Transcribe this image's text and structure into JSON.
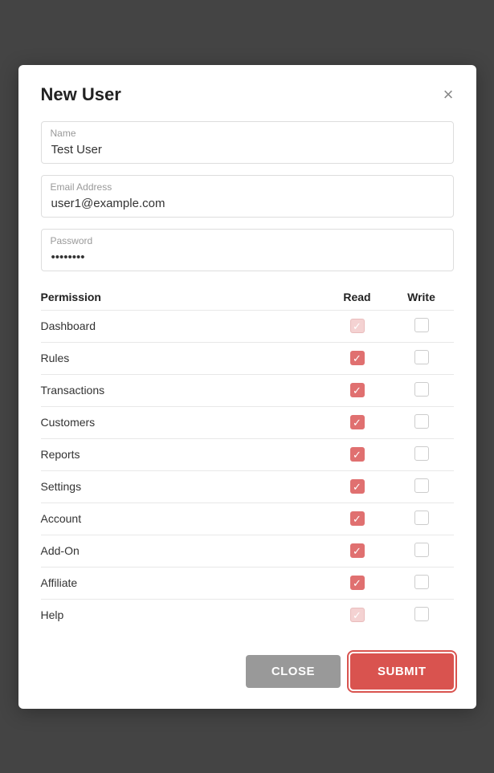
{
  "modal": {
    "title": "New User",
    "close_label": "×"
  },
  "form": {
    "name": {
      "label": "Name",
      "value": "Test User",
      "placeholder": "Name"
    },
    "email": {
      "label": "Email Address",
      "value": "user1@example.com",
      "placeholder": "Email Address"
    },
    "password": {
      "label": "Password",
      "value": "••••••••",
      "placeholder": "Password"
    }
  },
  "permissions": {
    "headers": [
      "Permission",
      "Read",
      "Write"
    ],
    "rows": [
      {
        "name": "Dashboard",
        "read": true,
        "read_disabled": true,
        "write": false
      },
      {
        "name": "Rules",
        "read": true,
        "read_disabled": false,
        "write": false
      },
      {
        "name": "Transactions",
        "read": true,
        "read_disabled": false,
        "write": false
      },
      {
        "name": "Customers",
        "read": true,
        "read_disabled": false,
        "write": false
      },
      {
        "name": "Reports",
        "read": true,
        "read_disabled": false,
        "write": false
      },
      {
        "name": "Settings",
        "read": true,
        "read_disabled": false,
        "write": false
      },
      {
        "name": "Account",
        "read": true,
        "read_disabled": false,
        "write": false
      },
      {
        "name": "Add-On",
        "read": true,
        "read_disabled": false,
        "write": false
      },
      {
        "name": "Affiliate",
        "read": true,
        "read_disabled": false,
        "write": false
      },
      {
        "name": "Help",
        "read": true,
        "read_disabled": true,
        "write": false
      }
    ]
  },
  "footer": {
    "close_label": "CLOSE",
    "submit_label": "SUBMIT"
  }
}
